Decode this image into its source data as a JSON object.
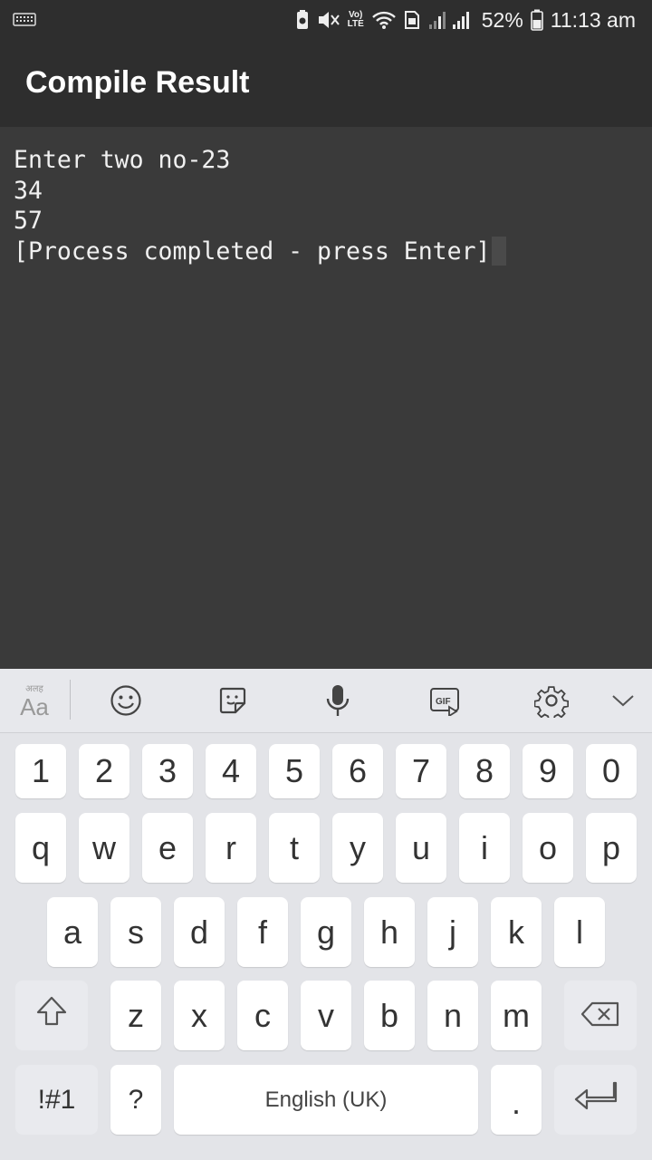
{
  "status_bar": {
    "volte_line1": "Vo)",
    "volte_line2": "LTE",
    "battery": "52%",
    "time": "11:13 am"
  },
  "app": {
    "title": "Compile Result"
  },
  "console": {
    "lines": [
      "Enter two no-23",
      "34",
      "57",
      "[Process completed - press Enter]"
    ]
  },
  "keyboard": {
    "toolbar": {
      "lang_small": "अलह",
      "lang_big": "Aa"
    },
    "number_row": [
      "1",
      "2",
      "3",
      "4",
      "5",
      "6",
      "7",
      "8",
      "9",
      "0"
    ],
    "row1": [
      "q",
      "w",
      "e",
      "r",
      "t",
      "y",
      "u",
      "i",
      "o",
      "p"
    ],
    "row2": [
      "a",
      "s",
      "d",
      "f",
      "g",
      "h",
      "j",
      "k",
      "l"
    ],
    "row3": [
      "z",
      "x",
      "c",
      "v",
      "b",
      "n",
      "m"
    ],
    "symbols_label": "!#1",
    "question_label": "?",
    "space_label": "English (UK)",
    "period_label": "."
  }
}
